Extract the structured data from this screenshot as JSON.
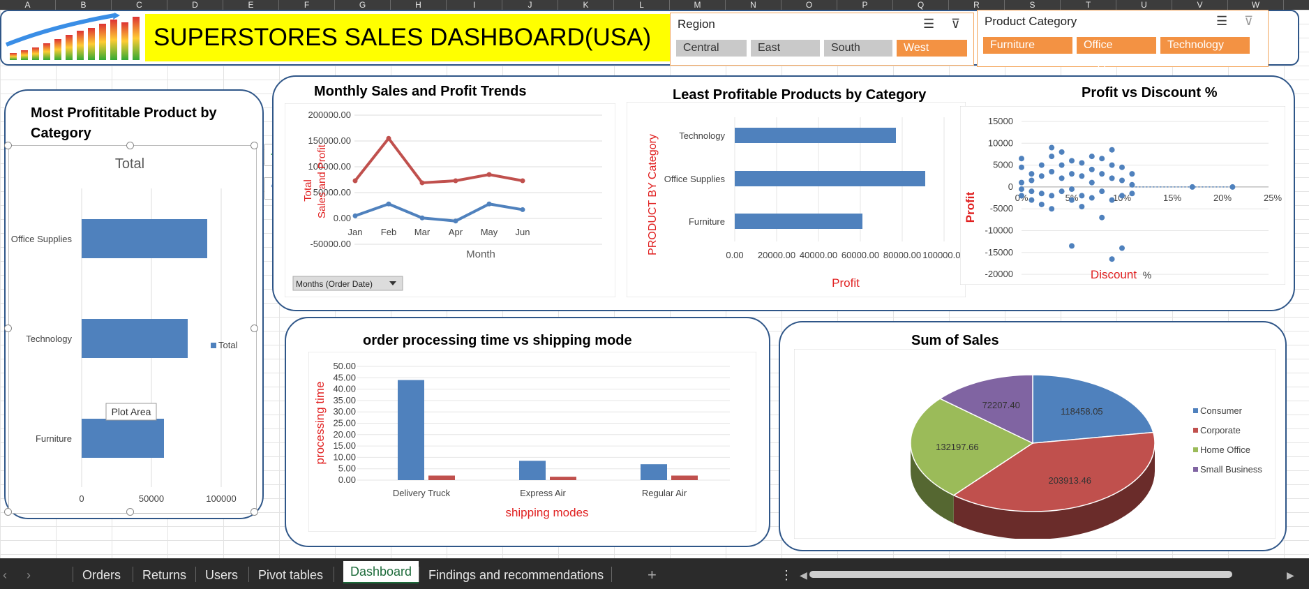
{
  "columns": [
    "A",
    "B",
    "C",
    "D",
    "E",
    "F",
    "G",
    "H",
    "I",
    "J",
    "K",
    "L",
    "M",
    "N",
    "O",
    "P",
    "Q",
    "R",
    "S",
    "T",
    "U",
    "V",
    "W"
  ],
  "dashboard": {
    "title": "SUPERSTORES SALES DASHBOARD(USA)",
    "title_bg": "#ffff00"
  },
  "region_slicer": {
    "title": "Region",
    "items": [
      {
        "label": "Central",
        "selected": false
      },
      {
        "label": "East",
        "selected": false
      },
      {
        "label": "South",
        "selected": false
      },
      {
        "label": "West",
        "selected": true
      }
    ]
  },
  "category_slicer": {
    "title": "Product Category",
    "items": [
      {
        "label": "Furniture",
        "selected": true
      },
      {
        "label": "Office Supplies",
        "selected": true
      },
      {
        "label": "Technology",
        "selected": true
      }
    ]
  },
  "charts": {
    "most_profitable": {
      "card_title": "Most Profititable Product by Category",
      "chart_title": "Total",
      "legend": "Total",
      "tooltip": "Plot Area",
      "ticks": [
        "0",
        "50000",
        "100000"
      ]
    },
    "monthly": {
      "title": "Monthly Sales and Profit  Trends",
      "ylabel_line1": "Total",
      "ylabel_line2": "Sales and Profit",
      "xlabel": "Month",
      "ticks": [
        "200000.00",
        "150000.00",
        "100000.00",
        "50000.00",
        "0.00",
        "-50000.00"
      ],
      "filter_button": "Months (Order Date)"
    },
    "least_profitable": {
      "title": "Least Profitable Products by Category",
      "ylabel": "PRODUCT BY Category",
      "xlabel": "Profit",
      "ticks": [
        "0.00",
        "20000.00",
        "40000.00",
        "60000.00",
        "80000.00",
        "100000.00"
      ]
    },
    "discount": {
      "title": "Profit vs Discount %",
      "ylabel": "Profit",
      "xlabel": "Discount",
      "xlabel_suffix": "%",
      "yticks": [
        "15000",
        "10000",
        "5000",
        "0",
        "-5000",
        "-10000",
        "-15000",
        "-20000"
      ],
      "xticks": [
        "0%",
        "5%",
        "10%",
        "15%",
        "20%",
        "25%"
      ]
    },
    "processing": {
      "title": "order processing time vs shipping mode",
      "ylabel": "processing time",
      "xlabel": "shipping modes",
      "ticks": [
        "50.00",
        "45.00",
        "40.00",
        "35.00",
        "30.00",
        "25.00",
        "20.00",
        "15.00",
        "10.00",
        "5.00",
        "0.00"
      ]
    },
    "sum_sales": {
      "title": "Sum of Sales"
    }
  },
  "chart_data": [
    {
      "id": "most_profitable",
      "type": "bar",
      "orientation": "horizontal",
      "title": "Total",
      "categories": [
        "Office Supplies",
        "Technology",
        "Furniture"
      ],
      "series": [
        {
          "name": "Total",
          "values": [
            90000,
            76000,
            59000
          ]
        }
      ],
      "xlim": [
        0,
        120000
      ],
      "color": "#4f81bd"
    },
    {
      "id": "monthly",
      "type": "line",
      "title": "Monthly Sales and Profit  Trends",
      "categories": [
        "Jan",
        "Feb",
        "Mar",
        "Apr",
        "May",
        "Jun"
      ],
      "series": [
        {
          "values": [
            73000,
            155000,
            69000,
            73000,
            85000,
            73000
          ],
          "color": "#c0504d"
        },
        {
          "values": [
            5000,
            28000,
            1000,
            -5000,
            28000,
            17000
          ],
          "color": "#4f81bd"
        }
      ],
      "ylim": [
        -50000,
        200000
      ],
      "ylabel": "Total Sales and Profit",
      "xlabel": "Month"
    },
    {
      "id": "least_profitable",
      "type": "bar",
      "orientation": "horizontal",
      "title": "Least Profitable Products by Category",
      "categories": [
        "Technology",
        "Office Supplies",
        "Furniture"
      ],
      "values": [
        77000,
        91000,
        61000
      ],
      "xlim": [
        0,
        120000
      ],
      "xlabel": "Profit",
      "ylabel": "PRODUCT BY Category",
      "color": "#4f81bd"
    },
    {
      "id": "discount",
      "type": "scatter",
      "title": "Profit vs Discount %",
      "xlim": [
        0,
        0.25
      ],
      "ylim": [
        -20000,
        15000
      ],
      "xlabel": "Discount %",
      "ylabel": "Profit",
      "points": [
        [
          0.0,
          6500
        ],
        [
          0.0,
          4500
        ],
        [
          0.0,
          1000
        ],
        [
          0.0,
          -2000
        ],
        [
          0.0,
          -500
        ],
        [
          0.01,
          3000
        ],
        [
          0.01,
          1500
        ],
        [
          0.01,
          -1000
        ],
        [
          0.01,
          -3000
        ],
        [
          0.02,
          5000
        ],
        [
          0.02,
          2500
        ],
        [
          0.02,
          -1500
        ],
        [
          0.02,
          -4000
        ],
        [
          0.03,
          9000
        ],
        [
          0.03,
          7000
        ],
        [
          0.03,
          3500
        ],
        [
          0.03,
          -2000
        ],
        [
          0.03,
          -5000
        ],
        [
          0.04,
          8000
        ],
        [
          0.04,
          5000
        ],
        [
          0.04,
          2000
        ],
        [
          0.04,
          -1000
        ],
        [
          0.05,
          6000
        ],
        [
          0.05,
          3000
        ],
        [
          0.05,
          -500
        ],
        [
          0.05,
          -3000
        ],
        [
          0.05,
          -13500
        ],
        [
          0.06,
          5500
        ],
        [
          0.06,
          2500
        ],
        [
          0.06,
          -2000
        ],
        [
          0.06,
          -4500
        ],
        [
          0.07,
          7000
        ],
        [
          0.07,
          4000
        ],
        [
          0.07,
          1000
        ],
        [
          0.07,
          -2500
        ],
        [
          0.08,
          6500
        ],
        [
          0.08,
          3000
        ],
        [
          0.08,
          -1000
        ],
        [
          0.08,
          -7000
        ],
        [
          0.09,
          8500
        ],
        [
          0.09,
          5000
        ],
        [
          0.09,
          2000
        ],
        [
          0.09,
          -3000
        ],
        [
          0.09,
          -16500
        ],
        [
          0.1,
          4500
        ],
        [
          0.1,
          1500
        ],
        [
          0.1,
          -2000
        ],
        [
          0.1,
          -14000
        ],
        [
          0.11,
          3000
        ],
        [
          0.11,
          500
        ],
        [
          0.11,
          -1500
        ],
        [
          0.17,
          0
        ],
        [
          0.21,
          0
        ]
      ],
      "color": "#4f81bd"
    },
    {
      "id": "processing",
      "type": "bar",
      "title": "order processing time vs shipping mode",
      "categories": [
        "Delivery Truck",
        "Express Air",
        "Regular Air"
      ],
      "series": [
        {
          "values": [
            44,
            8.5,
            7
          ],
          "color": "#4f81bd"
        },
        {
          "values": [
            2,
            1.5,
            2
          ],
          "color": "#c0504d"
        }
      ],
      "ylim": [
        0,
        50
      ],
      "xlabel": "shipping modes",
      "ylabel": "processing time"
    },
    {
      "id": "sum_sales",
      "type": "pie",
      "title": "Sum of Sales",
      "slices": [
        {
          "label": "Consumer",
          "value": 118458.05,
          "text": "118458.05",
          "color": "#4f81bd"
        },
        {
          "label": "Corporate",
          "value": 203913.46,
          "text": "203913.46",
          "color": "#c0504d"
        },
        {
          "label": "Home Office",
          "value": 132197.66,
          "text": "132197.66",
          "color": "#9bbb59"
        },
        {
          "label": "Small Business",
          "value": 72207.4,
          "text": "72207.40",
          "color": "#8064a2"
        }
      ]
    }
  ],
  "sheet_tabs": [
    {
      "label": "Orders",
      "active": false
    },
    {
      "label": "Returns",
      "active": false
    },
    {
      "label": "Users",
      "active": false
    },
    {
      "label": "Pivot tables",
      "active": false
    },
    {
      "label": "Dashboard",
      "active": true
    },
    {
      "label": "Findings and recommendations",
      "active": false
    }
  ],
  "tab_controls": {
    "prev": "‹",
    "next": "›",
    "add": "+",
    "more": "⋮"
  }
}
